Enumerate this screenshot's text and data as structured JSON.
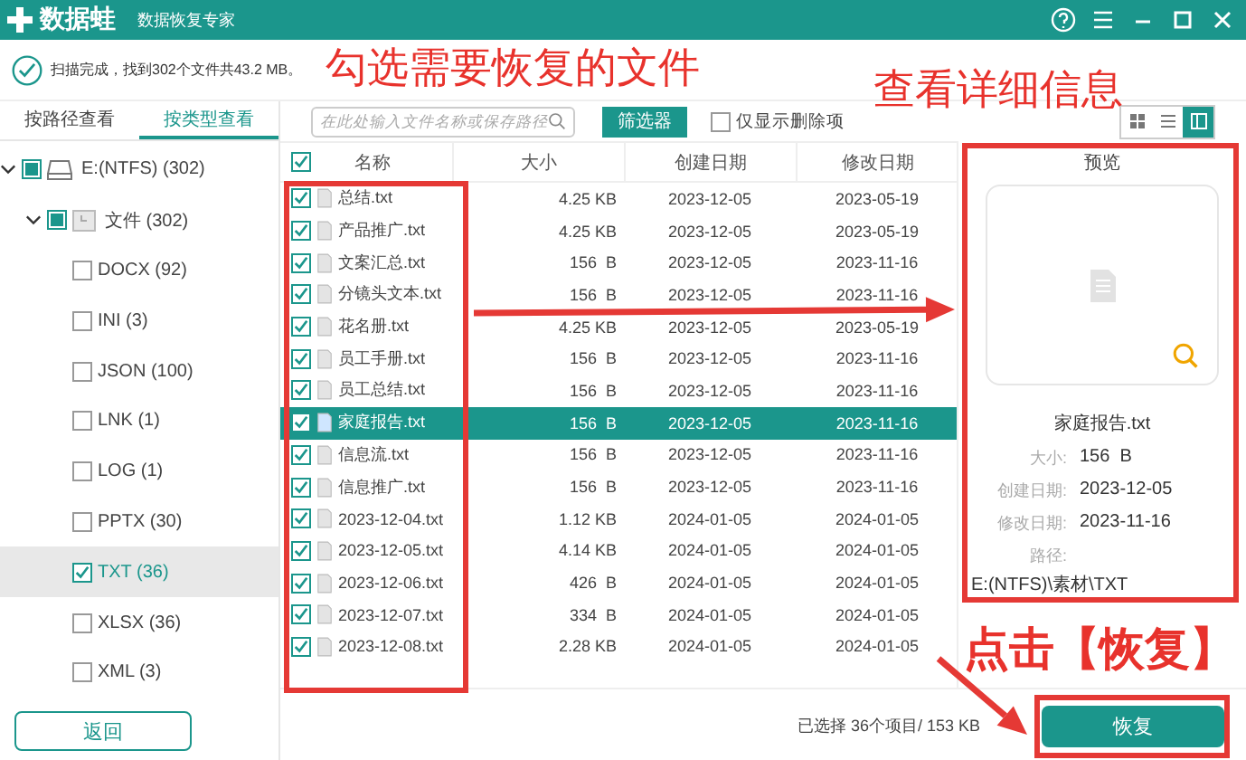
{
  "window": {
    "logo": "数据蛙",
    "subtitle": "数据恢复专家"
  },
  "scan_status": "扫描完成，找到302个文件共43.2 MB。",
  "tabs": [
    {
      "label": "按路径查看",
      "selected": false
    },
    {
      "label": "按类型查看",
      "selected": true
    }
  ],
  "search": {
    "placeholder": "在此处输入文件名称或保存路径"
  },
  "filter_button": "筛选器",
  "deleted_only": {
    "label": "仅显示删除项",
    "checked": false
  },
  "view_modes": [
    {
      "kind": "grid",
      "selected": false
    },
    {
      "kind": "list",
      "selected": false
    },
    {
      "kind": "detail",
      "selected": true
    }
  ],
  "tree": [
    {
      "kind": "drive",
      "label": "E:(NTFS) (302)",
      "checked": false,
      "partial": true,
      "expanded": true,
      "selected": false,
      "children": [
        {
          "kind": "folder",
          "label": "文件 (302)",
          "checked": false,
          "partial": true,
          "expanded": true,
          "selected": false,
          "children": [
            {
              "kind": "type",
              "label": "DOCX (92)",
              "checked": false,
              "selected": false
            },
            {
              "kind": "type",
              "label": "INI (3)",
              "checked": false,
              "selected": false
            },
            {
              "kind": "type",
              "label": "JSON (100)",
              "checked": false,
              "selected": false
            },
            {
              "kind": "type",
              "label": "LNK (1)",
              "checked": false,
              "selected": false
            },
            {
              "kind": "type",
              "label": "LOG (1)",
              "checked": false,
              "selected": false
            },
            {
              "kind": "type",
              "label": "PPTX (30)",
              "checked": false,
              "selected": false
            },
            {
              "kind": "type",
              "label": "TXT (36)",
              "checked": true,
              "selected": true
            },
            {
              "kind": "type",
              "label": "XLSX (36)",
              "checked": false,
              "selected": false
            },
            {
              "kind": "type",
              "label": "XML (3)",
              "checked": false,
              "selected": false
            }
          ]
        }
      ]
    }
  ],
  "back_button": "返回",
  "table": {
    "all_checked": true,
    "columns": [
      "名称",
      "大小",
      "创建日期",
      "修改日期"
    ],
    "rows": [
      {
        "name": "总结.txt",
        "size": "4.25 KB",
        "created": "2023-12-05",
        "modified": "2023-05-19",
        "checked": true,
        "selected": false
      },
      {
        "name": "产品推广.txt",
        "size": "4.25 KB",
        "created": "2023-12-05",
        "modified": "2023-05-19",
        "checked": true,
        "selected": false
      },
      {
        "name": "文案汇总.txt",
        "size": "156  B",
        "created": "2023-12-05",
        "modified": "2023-11-16",
        "checked": true,
        "selected": false
      },
      {
        "name": "分镜头文本.txt",
        "size": "156  B",
        "created": "2023-12-05",
        "modified": "2023-11-16",
        "checked": true,
        "selected": false
      },
      {
        "name": "花名册.txt",
        "size": "4.25 KB",
        "created": "2023-12-05",
        "modified": "2023-05-19",
        "checked": true,
        "selected": false
      },
      {
        "name": "员工手册.txt",
        "size": "156  B",
        "created": "2023-12-05",
        "modified": "2023-11-16",
        "checked": true,
        "selected": false
      },
      {
        "name": "员工总结.txt",
        "size": "156  B",
        "created": "2023-12-05",
        "modified": "2023-11-16",
        "checked": true,
        "selected": false
      },
      {
        "name": "家庭报告.txt",
        "size": "156  B",
        "created": "2023-12-05",
        "modified": "2023-11-16",
        "checked": true,
        "selected": true
      },
      {
        "name": "信息流.txt",
        "size": "156  B",
        "created": "2023-12-05",
        "modified": "2023-11-16",
        "checked": true,
        "selected": false
      },
      {
        "name": "信息推广.txt",
        "size": "156  B",
        "created": "2023-12-05",
        "modified": "2023-11-16",
        "checked": true,
        "selected": false
      },
      {
        "name": "2023-12-04.txt",
        "size": "1.12 KB",
        "created": "2024-01-05",
        "modified": "2024-01-05",
        "checked": true,
        "selected": false
      },
      {
        "name": "2023-12-05.txt",
        "size": "4.14 KB",
        "created": "2024-01-05",
        "modified": "2024-01-05",
        "checked": true,
        "selected": false
      },
      {
        "name": "2023-12-06.txt",
        "size": "426  B",
        "created": "2024-01-05",
        "modified": "2024-01-05",
        "checked": true,
        "selected": false
      },
      {
        "name": "2023-12-07.txt",
        "size": "334  B",
        "created": "2024-01-05",
        "modified": "2024-01-05",
        "checked": true,
        "selected": false
      },
      {
        "name": "2023-12-08.txt",
        "size": "2.28 KB",
        "created": "2024-01-05",
        "modified": "2024-01-05",
        "checked": true,
        "selected": false
      }
    ]
  },
  "preview": {
    "title": "预览",
    "filename": "家庭报告.txt",
    "details": [
      {
        "kind": "inline",
        "label": "大小:",
        "value": "156  B"
      },
      {
        "kind": "inline",
        "label": "创建日期:",
        "value": "2023-12-05"
      },
      {
        "kind": "inline",
        "label": "修改日期:",
        "value": "2023-11-16"
      },
      {
        "kind": "block",
        "label": "路径:",
        "value": "E:(NTFS)\\素材\\TXT"
      }
    ]
  },
  "selection_status": "已选择 36个项目/ 153 KB",
  "recover_button": "恢复",
  "annotations": [
    {
      "text": "勾选需要恢复的文件"
    },
    {
      "text": "查看详细信息"
    },
    {
      "text": "点击【恢复】"
    }
  ]
}
